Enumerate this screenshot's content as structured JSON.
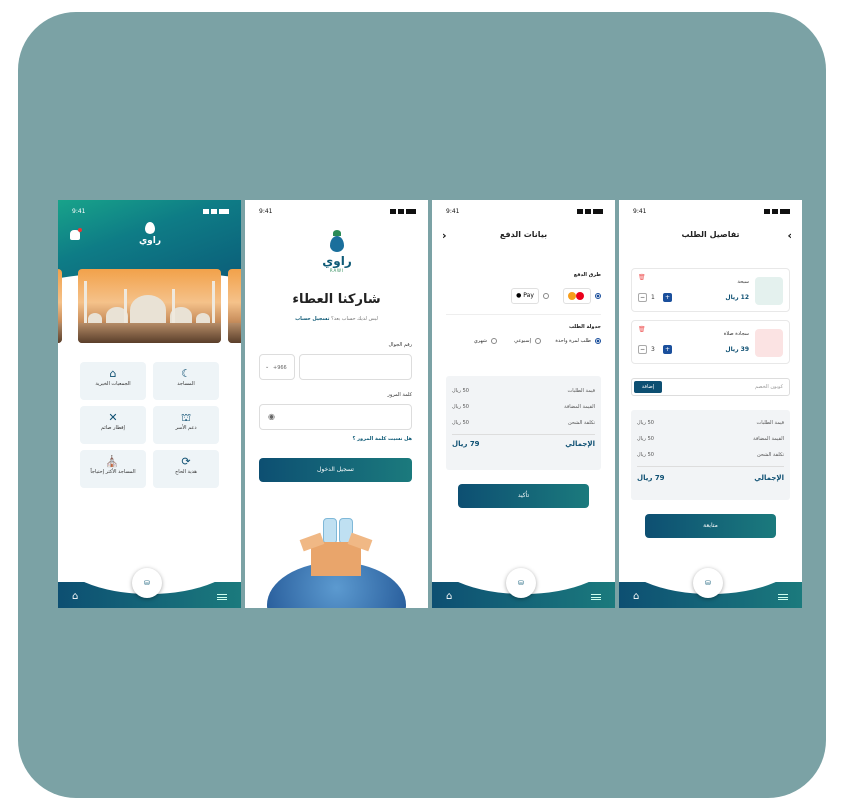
{
  "colors": {
    "background": "#7ba2a5",
    "primary": "#0d4f72",
    "accent": "#1b7a7d",
    "green": "#2a8a57"
  },
  "status_time": "9:41",
  "home": {
    "logo_text": "راوي",
    "tiles": [
      {
        "label": "المساجد",
        "icon": "mosque-icon"
      },
      {
        "label": "الجمعيات الخيرية",
        "icon": "building-icon"
      },
      {
        "label": "دعم الأسر",
        "icon": "family-icon"
      },
      {
        "label": "إفطار صائم",
        "icon": "meal-icon"
      },
      {
        "label": "هدية الحاج",
        "icon": "gift-icon"
      },
      {
        "label": "المساجد الأكثر إحتياجاً",
        "icon": "mosque-icon"
      }
    ]
  },
  "login": {
    "logo_text": "راوي",
    "logo_sub": "RAWI",
    "title": "شاركنا العطاء",
    "subtitle_text": "ليس لديك حساب بعد؟",
    "signup_link": "تسجيل حساب",
    "phone_label": "رقم الجوال",
    "country_code": "+966",
    "password_label": "كلمة المرور",
    "forgot_link": "هل نسيت كلمة المرور ؟",
    "login_button": "تسجيل الدخول"
  },
  "payment": {
    "title": "بيانات الدفع",
    "methods_title": "طرق الدفع",
    "apple_pay": "Pay",
    "schedule_title": "جدولة الطلب",
    "options": [
      "طلب لمرة واحدة",
      "إسبوعي",
      "شهري"
    ],
    "summary": [
      {
        "label": "قيمة الطلبات",
        "value": "50 ريال"
      },
      {
        "label": "القيمة المضافة",
        "value": "50 ريال"
      },
      {
        "label": "تكلفة الشحن",
        "value": "50 ريال"
      }
    ],
    "total_label": "الإجمالي",
    "total_value": "79 ريال",
    "confirm_button": "تأكيد"
  },
  "order": {
    "title": "تفاصيل الطلب",
    "items": [
      {
        "name": "سبحة",
        "price": "12 ريال",
        "qty": "1"
      },
      {
        "name": "سجادة صلاة",
        "price": "39 ريال",
        "qty": "3"
      }
    ],
    "coupon_placeholder": "كوبون الخصم",
    "apply_button": "إضافة",
    "summary": [
      {
        "label": "قيمة الطلبات",
        "value": "50 ريال"
      },
      {
        "label": "القيمة المضافة",
        "value": "50 ريال"
      },
      {
        "label": "تكلفة الشحن",
        "value": "50 ريال"
      }
    ],
    "total_label": "الإجمالي",
    "total_value": "79 ريال",
    "continue_button": "متابعة"
  }
}
